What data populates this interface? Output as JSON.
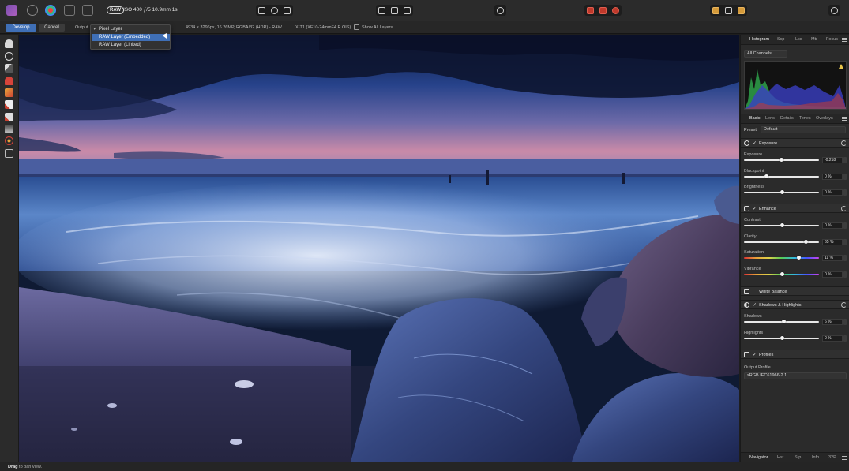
{
  "toolbar": {
    "raw_badge": "RAW",
    "exif": "ISO 400 ƒ/5 10.9mm 1s"
  },
  "context_bar": {
    "develop_label": "Develop",
    "cancel_label": "Cancel",
    "output_label": "Output",
    "image_info": "4934 × 3296px, 16.26MP, RGBA/32 (HDR) - RAW",
    "lens_info": "X-T1 (XF10-24mmF4 R OIS)",
    "show_all_layers": "Show All Layers"
  },
  "output_dropdown": {
    "items": [
      {
        "label": "Pixel Layer",
        "checked": true,
        "highlighted": false
      },
      {
        "label": "RAW Layer (Embedded)",
        "checked": false,
        "highlighted": true
      },
      {
        "label": "RAW Layer (Linked)",
        "checked": false,
        "highlighted": false
      }
    ]
  },
  "histogram_panel": {
    "tabs": [
      "Histogram",
      "Scp",
      "Lcs",
      "Mtr",
      "Focus"
    ],
    "channel_select": "All Channels"
  },
  "develop_panel": {
    "tabs": [
      "Basic",
      "Lens",
      "Details",
      "Tones",
      "Overlays"
    ],
    "preset_label": "Preset:",
    "preset_value": "Default",
    "exposure": {
      "title": "Exposure",
      "sliders": [
        {
          "label": "Exposure",
          "value": "-0.218",
          "position": 0.49
        },
        {
          "label": "Blackpoint",
          "value": "0 %",
          "position": 0.29
        },
        {
          "label": "Brightness",
          "value": "0 %",
          "position": 0.5
        }
      ]
    },
    "enhance": {
      "title": "Enhance",
      "sliders": [
        {
          "label": "Contrast",
          "value": "0 %",
          "position": 0.5
        },
        {
          "label": "Clarity",
          "value": "65 %",
          "position": 0.82
        },
        {
          "label": "Saturation",
          "value": "11 %",
          "position": 0.73,
          "gradient": true
        },
        {
          "label": "Vibrance",
          "value": "0 %",
          "position": 0.5,
          "gradient": true
        }
      ]
    },
    "white_balance": {
      "title": "White Balance"
    },
    "shadows_highlights": {
      "title": "Shadows & Highlights",
      "sliders": [
        {
          "label": "Shadows",
          "value": "6 %",
          "position": 0.53
        },
        {
          "label": "Highlights",
          "value": "0 %",
          "position": 0.5
        }
      ]
    },
    "profiles": {
      "title": "Profiles",
      "output_profile_label": "Output Profile",
      "output_profile_value": "sRGB IEC61966-2.1"
    }
  },
  "bottom_tabs": [
    "Navigator",
    "Hst",
    "Stp",
    "Info",
    "32P"
  ],
  "status": {
    "bold": "Drag",
    "rest": " to pan view."
  },
  "colors": {
    "accent": "#3f6fb6",
    "panel_bg": "#2b2b2b"
  }
}
